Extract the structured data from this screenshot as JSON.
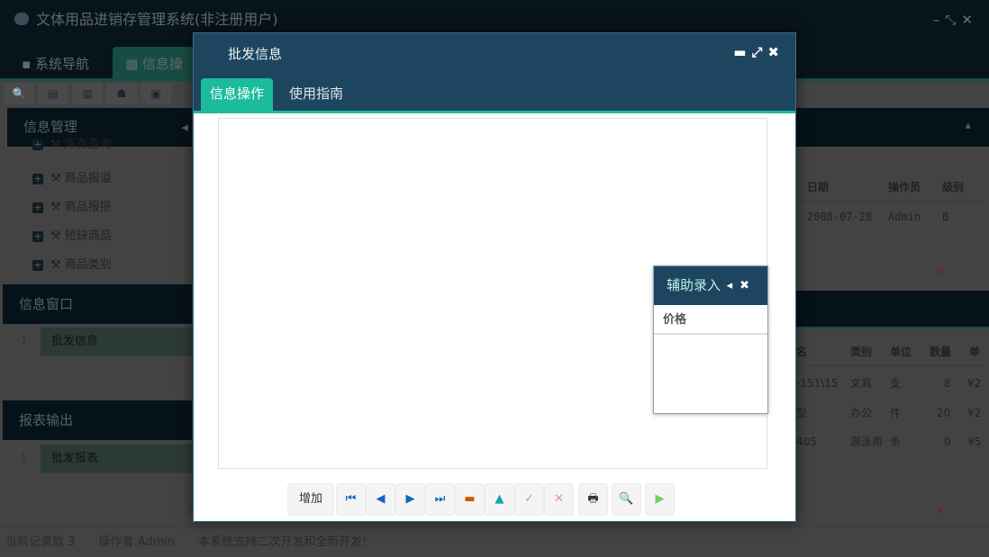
{
  "app": {
    "title": "文体用品进销存管理系统(非注册用户)",
    "window_controls": [
      "–",
      "⤡",
      "✕"
    ]
  },
  "main_tabs": [
    {
      "label": "系统导航"
    },
    {
      "label": "信息操作"
    }
  ],
  "sidebar": {
    "sections": [
      {
        "title": "信息管理",
        "items": [
          "库存查询",
          "商品报溢",
          "商品报损",
          "短缺商品",
          "商品类别"
        ]
      },
      {
        "title": "信息窗口",
        "rows": [
          {
            "no": "1",
            "label": "批发信息"
          }
        ]
      },
      {
        "title": "报表输出",
        "rows": [
          {
            "no": "1",
            "label": "批发报表"
          }
        ]
      }
    ]
  },
  "grid1": {
    "headers": [
      "日期",
      "操作员",
      "级别"
    ],
    "rows": [
      [
        "2008-07-28",
        "Admin",
        "B"
      ]
    ]
  },
  "grid2": {
    "headers": [
      "名",
      "类别",
      "单位",
      "数量",
      "单"
    ],
    "rows": [
      [
        "-151\\15",
        "文具",
        "支",
        "8",
        "¥2"
      ],
      [
        "型",
        "办公",
        "件",
        "20",
        "¥2"
      ],
      [
        "405",
        "游泳用",
        "条",
        "0",
        "¥5"
      ]
    ]
  },
  "status": {
    "records": "当前记录数 3",
    "operator": "操作者:Admin",
    "note": "本系统支持二次开发和全新开发!"
  },
  "modal": {
    "title": "批发信息",
    "tabs": [
      {
        "label": "信息操作",
        "active": true
      },
      {
        "label": "使用指南",
        "active": false
      }
    ],
    "toolbar": {
      "add_label": "增加"
    },
    "aux_panel": {
      "title": "辅助录入",
      "column": "价格"
    }
  },
  "colors": {
    "accent": "#1abc9c",
    "header": "#1d4560"
  }
}
